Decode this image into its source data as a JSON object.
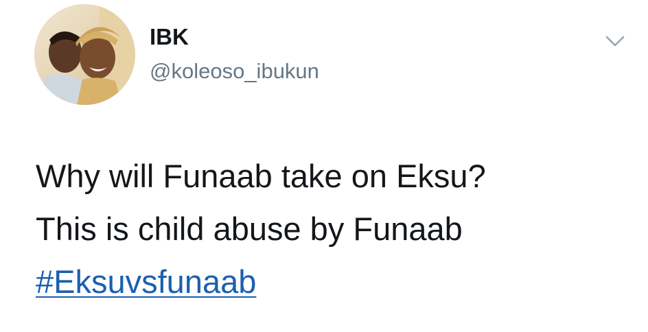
{
  "tweet": {
    "author": {
      "display_name": "IBK",
      "handle": "@koleoso_ibukun",
      "avatar_icon": "profile-photo"
    },
    "menu_icon": "chevron-down-icon",
    "text_lines": [
      "Why will Funaab take on Eksu?",
      "This is child abuse by Funaab"
    ],
    "hashtag": "#Eksuvsfunaab"
  },
  "colors": {
    "text": "#14171a",
    "handle": "#657786",
    "hashtag": "#1b5fb0",
    "caret": "#9aa4ad"
  }
}
